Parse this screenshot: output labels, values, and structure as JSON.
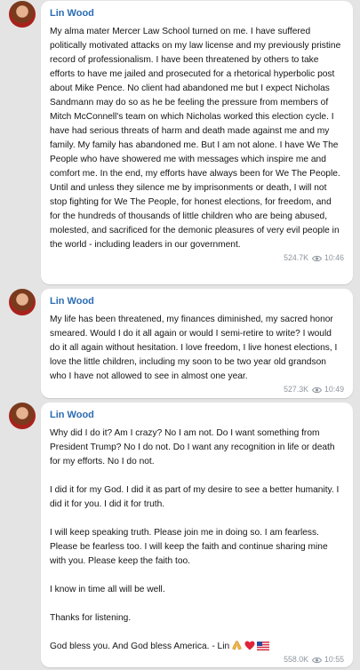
{
  "posts": [
    {
      "author": "Lin Wood",
      "paragraphs": [
        "My alma mater Mercer Law School turned on me. I have suffered politically motivated attacks on my law license and my previously pristine record of professionalism. I have been threatened by others to take efforts to have me jailed and prosecuted for a rhetorical hyperbolic post about Mike Pence. No client had abandoned me but I expect Nicholas Sandmann may do so as he be feeling the pressure from members of Mitch McConnell's team on which Nicholas worked this election cycle. I have had serious threats of harm and death made against me and my family. My family has abandoned me. But I am not alone. I have We The People who have showered me with messages which inspire me and comfort me. In the end, my efforts have always been for We The People. Until and unless they silence me by imprisonments or death, I will not stop fighting for We The People, for honest elections, for freedom, and for the hundreds of thousands of little children who are being abused, molested, and sacrificed for the demonic pleasures of very evil people in the world - including leaders in our government."
      ],
      "views": "524.7K",
      "time": "10:46"
    },
    {
      "author": "Lin Wood",
      "paragraphs": [
        "My life has been threatened, my finances diminished, my sacred honor smeared. Would I do it all again or would I semi-retire to write? I would do it all again without hesitation. I love freedom, I live honest elections, I love the little children, including my soon to be two year old grandson who I have not allowed to see in almost one year."
      ],
      "views": "527.3K",
      "time": "10:49"
    },
    {
      "author": "Lin Wood",
      "paragraphs": [
        "Why did I do it? Am I crazy? No I am not. Do I want something from President Trump? No I do not. Do I want any recognition in life or death for my efforts. No I do not.",
        "I did it for my God. I did it as part of my desire to see a better humanity. I did it for you. I did it for truth.",
        "I will keep speaking truth. Please join me in doing so. I am fearless. Please be fearless too. I will keep the faith and continue sharing mine with you. Please keep the faith too.",
        "I know in time all will be well.",
        "Thanks for listening.",
        "God bless you. And God bless America. - Lin"
      ],
      "emoji": [
        "praying-hands",
        "red-heart",
        "us-flag"
      ],
      "views": "558.0K",
      "time": "10:55"
    }
  ],
  "colors": {
    "author": "#2b6cb3",
    "meta": "#8d96a0",
    "background": "#e4e4e4"
  }
}
